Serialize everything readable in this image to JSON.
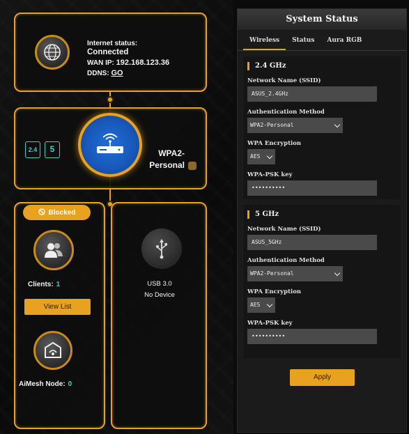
{
  "map": {
    "internet": {
      "status_label": "Internet status:",
      "status_value": "Connected",
      "wan_label": "WAN IP:",
      "wan_ip": "192.168.123.36",
      "ddns_label": "DDNS:",
      "ddns_link": "GO"
    },
    "router": {
      "band_24": "2.4",
      "band_5": "5",
      "security_line1": "WPA2-",
      "security_line2": "Personal"
    },
    "clients": {
      "blocked_label": "Blocked",
      "clients_label": "Clients:",
      "clients_count": "1",
      "view_list_label": "View List",
      "aimesh_label": "AiMesh Node:",
      "aimesh_count": "0"
    },
    "usb": {
      "name": "USB 3.0",
      "status": "No Device"
    }
  },
  "panel": {
    "title": "System Status",
    "tabs": [
      {
        "label": "Wireless"
      },
      {
        "label": "Status"
      },
      {
        "label": "Aura RGB"
      }
    ],
    "bands": [
      {
        "title": "2.4 GHz",
        "ssid_label": "Network Name (SSID)",
        "ssid_value": "ASUS_2.4GHz",
        "auth_label": "Authentication Method",
        "auth_value": "WPA2-Personal",
        "enc_label": "WPA Encryption",
        "enc_value": "AES",
        "psk_label": "WPA-PSK key",
        "psk_value": "••••••••••"
      },
      {
        "title": "5 GHz",
        "ssid_label": "Network Name (SSID)",
        "ssid_value": "ASUS_5GHz",
        "auth_label": "Authentication Method",
        "auth_value": "WPA2-Personal",
        "enc_label": "WPA Encryption",
        "enc_value": "AES",
        "psk_label": "WPA-PSK key",
        "psk_value": "••••••••••"
      }
    ],
    "apply_label": "Apply"
  },
  "colors": {
    "accent": "#e9a21f",
    "cyan": "#3ed0c8",
    "router_blue": "#1f6ed8"
  },
  "icons": [
    "globe-icon",
    "router-icon",
    "users-icon",
    "usb-icon",
    "aimesh-icon",
    "blocked-icon",
    "lock-icon"
  ]
}
